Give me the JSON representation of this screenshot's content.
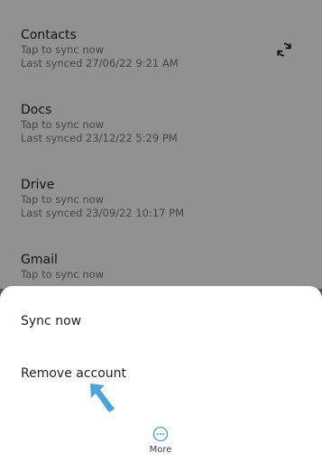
{
  "accounts": [
    {
      "title": "Contacts",
      "status": "Tap to sync now",
      "last_synced": "Last synced 27/06/22 9:21 AM"
    },
    {
      "title": "Docs",
      "status": "Tap to sync now",
      "last_synced": "Last synced 23/12/22 5:29 PM"
    },
    {
      "title": "Drive",
      "status": "Tap to sync now",
      "last_synced": "Last synced 23/09/22 10:17 PM"
    },
    {
      "title": "Gmail",
      "status": "Tap to sync now"
    }
  ],
  "icons": {
    "sync": "sync-icon",
    "more": "more-horizontal-icon",
    "pointer": "arrow-pointer-icon"
  },
  "sheet": {
    "sync_now": "Sync now",
    "remove_account": "Remove account",
    "more_label": "More"
  },
  "colors": {
    "accent": "#4aa3df",
    "scrim": "#8e8e8e",
    "sheet": "#ffffff"
  }
}
